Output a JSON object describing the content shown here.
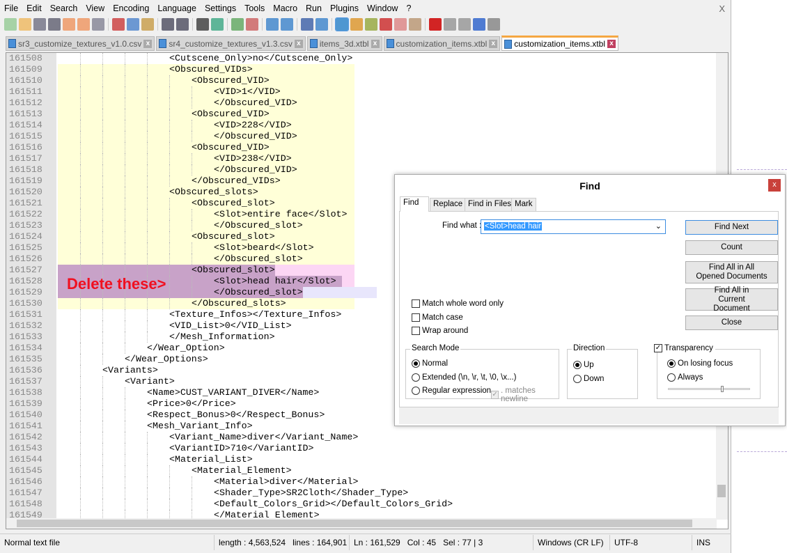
{
  "menu": [
    "File",
    "Edit",
    "Search",
    "View",
    "Encoding",
    "Language",
    "Settings",
    "Tools",
    "Macro",
    "Run",
    "Plugins",
    "Window",
    "?"
  ],
  "window_close": "X",
  "toolbar": [
    "new-file",
    "open-file",
    "save",
    "save-all",
    "close",
    "close-all",
    "print",
    "cut",
    "copy",
    "paste",
    "undo",
    "redo",
    "find",
    "replace",
    "zoom-in",
    "zoom-out",
    "sync-vertical",
    "sync-horizontal",
    "word-wrap",
    "show-all-chars",
    "indent-guide",
    "user-defined-language",
    "doc-map",
    "function-list",
    "folder-as-workspace",
    "monitoring",
    "record-macro",
    "stop-recording",
    "play-macro",
    "run-macro-multiple",
    "save-macro"
  ],
  "tabs": [
    {
      "label": "sr3_customize_textures_v1.0.csv",
      "active": false
    },
    {
      "label": "sr4_customize_textures_v1.3.csv",
      "active": false
    },
    {
      "label": "items_3d.xtbl",
      "active": false
    },
    {
      "label": "customization_items.xtbl",
      "active": false
    },
    {
      "label": "customization_items.xtbl",
      "active": true
    }
  ],
  "lines": [
    {
      "n": "161508",
      "indent": 5,
      "text": "<Cutscene_Only>no</Cutscene_Only>"
    },
    {
      "n": "161509",
      "indent": 5,
      "text": "<Obscured_VIDs>"
    },
    {
      "n": "161510",
      "indent": 6,
      "text": "<Obscured_VID>"
    },
    {
      "n": "161511",
      "indent": 7,
      "text": "<VID>1</VID>"
    },
    {
      "n": "161512",
      "indent": 7,
      "text": "</Obscured_VID>"
    },
    {
      "n": "161513",
      "indent": 6,
      "text": "<Obscured_VID>"
    },
    {
      "n": "161514",
      "indent": 7,
      "text": "<VID>228</VID>"
    },
    {
      "n": "161515",
      "indent": 7,
      "text": "</Obscured_VID>"
    },
    {
      "n": "161516",
      "indent": 6,
      "text": "<Obscured_VID>"
    },
    {
      "n": "161517",
      "indent": 7,
      "text": "<VID>238</VID>"
    },
    {
      "n": "161518",
      "indent": 7,
      "text": "</Obscured_VID>"
    },
    {
      "n": "161519",
      "indent": 6,
      "text": "</Obscured_VIDs>"
    },
    {
      "n": "161520",
      "indent": 5,
      "text": "<Obscured_slots>"
    },
    {
      "n": "161521",
      "indent": 6,
      "text": "<Obscured_slot>"
    },
    {
      "n": "161522",
      "indent": 7,
      "text": "<Slot>entire face</Slot>"
    },
    {
      "n": "161523",
      "indent": 7,
      "text": "</Obscured_slot>"
    },
    {
      "n": "161524",
      "indent": 6,
      "text": "<Obscured_slot>"
    },
    {
      "n": "161525",
      "indent": 7,
      "text": "<Slot>beard</Slot>"
    },
    {
      "n": "161526",
      "indent": 7,
      "text": "</Obscured_slot>"
    },
    {
      "n": "161527",
      "indent": 6,
      "text": "<Obscured_slot>"
    },
    {
      "n": "161528",
      "indent": 7,
      "text": "<Slot>head hair</Slot>"
    },
    {
      "n": "161529",
      "indent": 7,
      "text": "</Obscured_slot>"
    },
    {
      "n": "161530",
      "indent": 6,
      "text": "</Obscured_slots>"
    },
    {
      "n": "161531",
      "indent": 5,
      "text": "<Texture_Infos></Texture_Infos>"
    },
    {
      "n": "161532",
      "indent": 5,
      "text": "<VID_List>0</VID_List>"
    },
    {
      "n": "161533",
      "indent": 5,
      "text": "</Mesh_Information>"
    },
    {
      "n": "161534",
      "indent": 4,
      "text": "</Wear_Option>"
    },
    {
      "n": "161535",
      "indent": 3,
      "text": "</Wear_Options>"
    },
    {
      "n": "161536",
      "indent": 2,
      "text": "<Variants>"
    },
    {
      "n": "161537",
      "indent": 3,
      "text": "<Variant>"
    },
    {
      "n": "161538",
      "indent": 4,
      "text": "<Name>CUST_VARIANT_DIVER</Name>"
    },
    {
      "n": "161539",
      "indent": 4,
      "text": "<Price>0</Price>"
    },
    {
      "n": "161540",
      "indent": 4,
      "text": "<Respect_Bonus>0</Respect_Bonus>"
    },
    {
      "n": "161541",
      "indent": 4,
      "text": "<Mesh_Variant_Info>"
    },
    {
      "n": "161542",
      "indent": 5,
      "text": "<Variant_Name>diver</Variant_Name>"
    },
    {
      "n": "161543",
      "indent": 5,
      "text": "<VariantID>710</VariantID>"
    },
    {
      "n": "161544",
      "indent": 5,
      "text": "<Material_List>"
    },
    {
      "n": "161545",
      "indent": 6,
      "text": "<Material_Element>"
    },
    {
      "n": "161546",
      "indent": 7,
      "text": "<Material>diver</Material>"
    },
    {
      "n": "161547",
      "indent": 7,
      "text": "<Shader_Type>SR2Cloth</Shader_Type>"
    },
    {
      "n": "161548",
      "indent": 7,
      "text": "<Default_Colors_Grid></Default_Colors_Grid>"
    },
    {
      "n": "161549",
      "indent": 7,
      "text": "</Material_Element>"
    }
  ],
  "highlight": {
    "block_lines": [
      "161509",
      "161530"
    ],
    "selected_lines": [
      "161527",
      "161528",
      "161529"
    ],
    "block_color": "#ffffd8",
    "selection_color": "#c8a2c8"
  },
  "annotation": "Delete these>",
  "status": {
    "file_type": "Normal text file",
    "length": "length : 4,563,524",
    "lines": "lines : 164,901",
    "ln": "Ln : 161,529",
    "col": "Col : 45",
    "sel": "Sel : 77 | 3",
    "eol": "Windows (CR LF)",
    "encoding": "UTF-8",
    "mode": "INS"
  },
  "find": {
    "title": "Find",
    "close": "x",
    "tabs": [
      "Find",
      "Replace",
      "Find in Files",
      "Mark"
    ],
    "find_what_label": "Find what :",
    "find_what_value": "<Slot>head hair",
    "buttons": [
      "Find Next",
      "Count",
      "Find All in All Opened Documents",
      "Find All in Current Document",
      "Close"
    ],
    "options": [
      {
        "label": "Match whole word only",
        "checked": false
      },
      {
        "label": "Match case",
        "checked": false
      },
      {
        "label": "Wrap around",
        "checked": false
      }
    ],
    "search_mode": {
      "title": "Search Mode",
      "options": [
        "Normal",
        "Extended (\\n, \\r, \\t, \\0, \\x...)",
        "Regular expression"
      ],
      "selected": 0,
      "matches_newline": ". matches newline"
    },
    "direction": {
      "title": "Direction",
      "options": [
        "Up",
        "Down"
      ],
      "selected": 0
    },
    "transparency": {
      "title": "Transparency",
      "checked": true,
      "options": [
        "On losing focus",
        "Always"
      ],
      "selected": 0,
      "level": 0.65
    }
  }
}
